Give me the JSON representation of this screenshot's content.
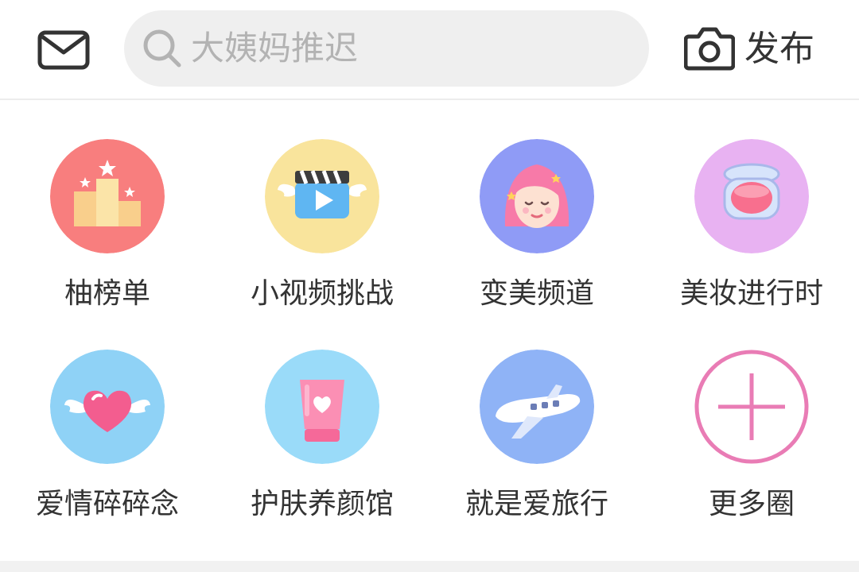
{
  "header": {
    "search": {
      "placeholder": "大姨妈推迟"
    },
    "publish_label": "发布",
    "icons": {
      "mail": "mail-icon",
      "search": "search-icon",
      "camera": "camera-icon"
    }
  },
  "channels": [
    {
      "label": "柚榜单",
      "icon": "podium-icon",
      "bg": "#f87e7e"
    },
    {
      "label": "小视频挑战",
      "icon": "video-clapper-icon",
      "bg": "#f9e49c"
    },
    {
      "label": "变美频道",
      "icon": "girl-face-icon",
      "bg": "#8f9bf6"
    },
    {
      "label": "美妆进行时",
      "icon": "blush-compact-icon",
      "bg": "#e8b2f2"
    },
    {
      "label": "爱情碎碎念",
      "icon": "winged-heart-icon",
      "bg": "#8fd2f6"
    },
    {
      "label": "护肤养颜馆",
      "icon": "skincare-tube-icon",
      "bg": "#9adbf9"
    },
    {
      "label": "就是爱旅行",
      "icon": "airplane-icon",
      "bg": "#8fb3f6"
    },
    {
      "label": "更多圈",
      "icon": "plus-icon",
      "bg": "#ffffff"
    }
  ],
  "colors": {
    "accent_pink": "#e97cb5",
    "search_bg": "#efefef",
    "divider": "#ececec"
  }
}
